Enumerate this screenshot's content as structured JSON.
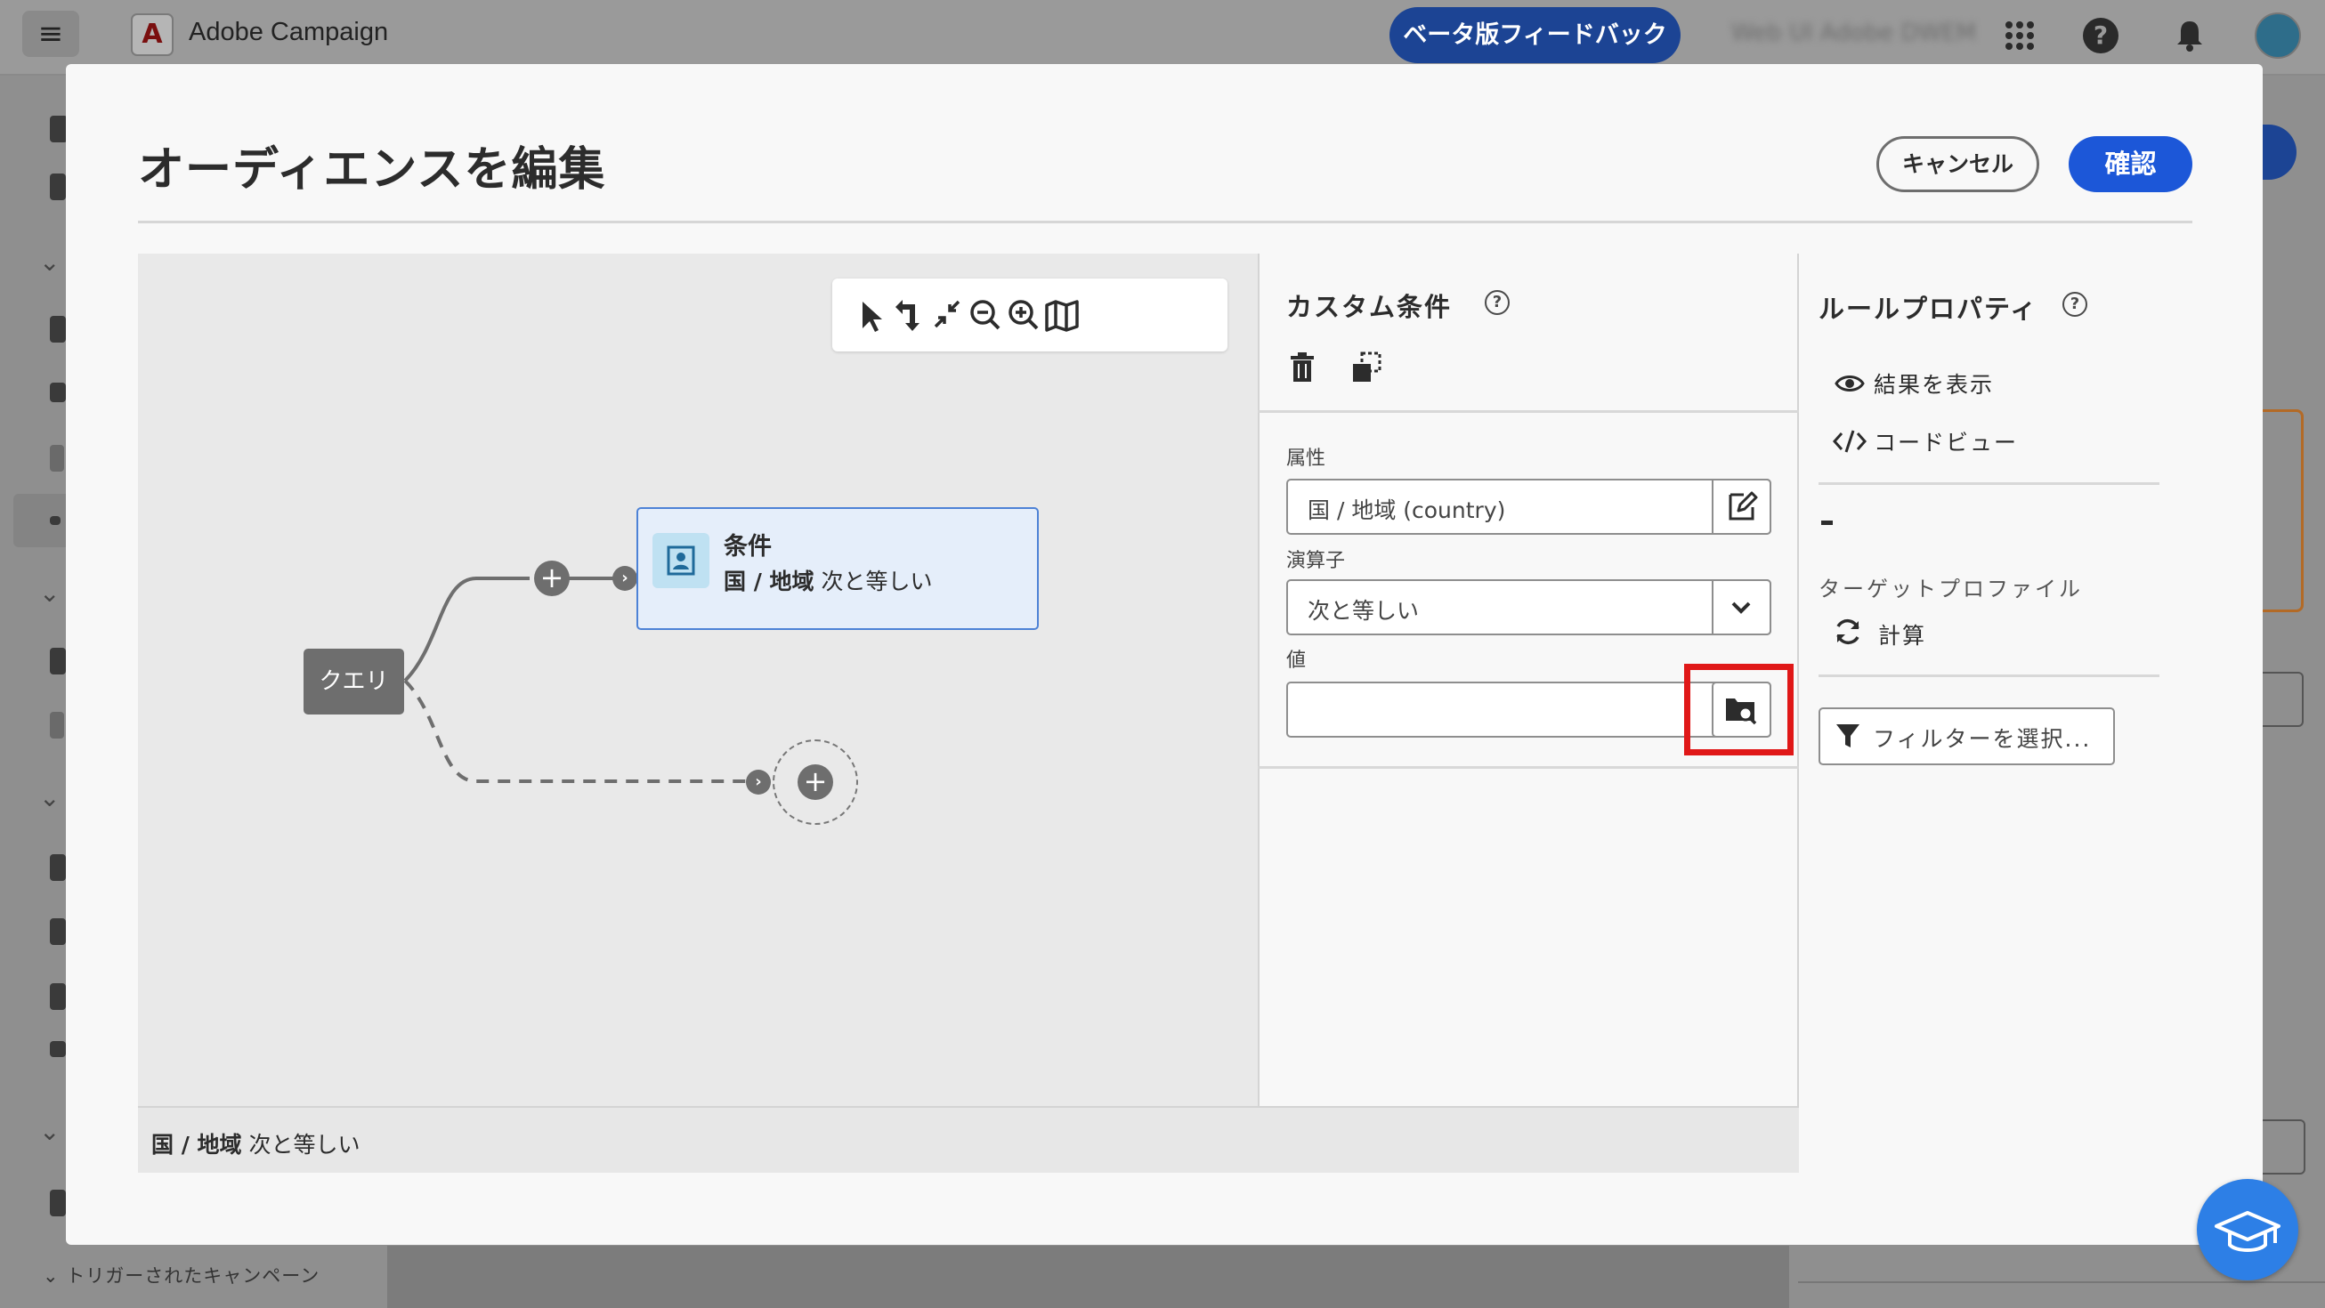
{
  "app": {
    "menu_icon": "hamburger-icon",
    "logo": "adobe-logo",
    "title": "Adobe Campaign",
    "beta_feedback": "ベータ版フィードバック",
    "org_name": "Web UI Adobe DWEM",
    "grid_icon": "apps-grid-icon",
    "help_icon": "help-icon",
    "bell_icon": "notification-bell-icon"
  },
  "sidebar": {
    "bottom_section_label": "トリガーされたキャンペーン"
  },
  "modal": {
    "title": "オーディエンスを編集",
    "cancel_label": "キャンセル",
    "confirm_label": "確認"
  },
  "canvas": {
    "toolbar": [
      "select-pointer-icon",
      "reroute-icon",
      "collapse-icon",
      "zoom-out-icon",
      "zoom-in-icon",
      "map-icon"
    ],
    "query_label": "クエリ",
    "condition_node": {
      "title": "条件",
      "attribute": "国 / 地域",
      "operator_text": "次と等しい"
    },
    "footer": {
      "attribute": "国 / 地域",
      "operator_text": "次と等しい"
    }
  },
  "custom_condition": {
    "title": "カスタム条件",
    "attribute_label": "属性",
    "attribute_value": "国 / 地域 (country)",
    "operator_label": "演算子",
    "operator_value": "次と等しい",
    "value_label": "値",
    "value_input": ""
  },
  "rule_properties": {
    "title": "ルールプロパティ",
    "show_results": "結果を表示",
    "code_view": "コードビュー",
    "count_value": "-",
    "target_profile": "ターゲットプロファイル",
    "calculate": "計算",
    "select_filter": "フィルターを選択..."
  },
  "colors": {
    "accent": "#1c57d8",
    "beta_button": "#1c4494",
    "highlight": "#e01818",
    "node_selected_bg": "#e5eefa"
  }
}
